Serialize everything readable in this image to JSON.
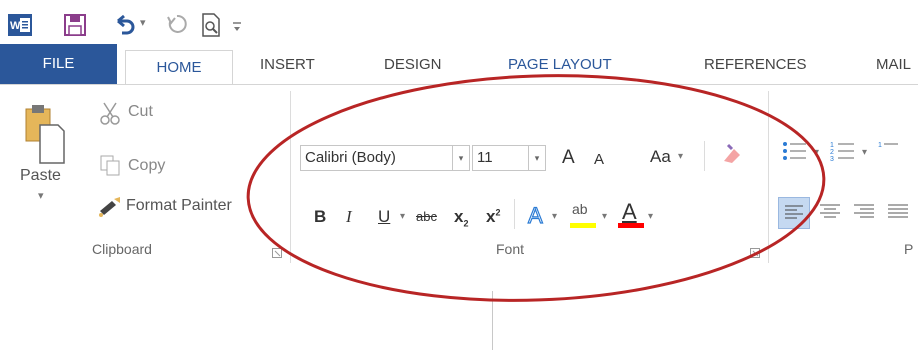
{
  "qat": {
    "word_icon": "word-app-icon",
    "save_icon": "save-icon",
    "undo_icon": "undo-icon",
    "undo_arrow": "▾",
    "redo_icon": "redo-icon",
    "preview_icon": "print-preview-icon",
    "customize_icon": "customize-qat-icon"
  },
  "tabs": {
    "file": "FILE",
    "home": "HOME",
    "insert": "INSERT",
    "design": "DESIGN",
    "page_layout": "PAGE LAYOUT",
    "references": "REFERENCES",
    "mailings_partial": "MAIL"
  },
  "clipboard": {
    "paste": "Paste",
    "paste_arrow": "▾",
    "cut": "Cut",
    "copy": "Copy",
    "format_painter": "Format Painter",
    "group_label": "Clipboard"
  },
  "font": {
    "font_name": "Calibri (Body)",
    "font_size": "11",
    "grow_font": "A",
    "shrink_font": "A",
    "change_case": "Aa",
    "bold": "B",
    "italic": "I",
    "underline": "U",
    "strikethrough": "abc",
    "subscript": "x",
    "superscript": "x",
    "text_effects": "A",
    "highlight": "ab",
    "font_color": "A",
    "group_label": "Font"
  },
  "paragraph": {
    "group_label_partial": "P"
  },
  "colors": {
    "accent": "#2b579a",
    "annotation_ellipse": "#b82525",
    "highlight_yellow": "#ffff00",
    "font_color_red": "#ff0000",
    "selected_align_bg": "#c5d9f1"
  }
}
